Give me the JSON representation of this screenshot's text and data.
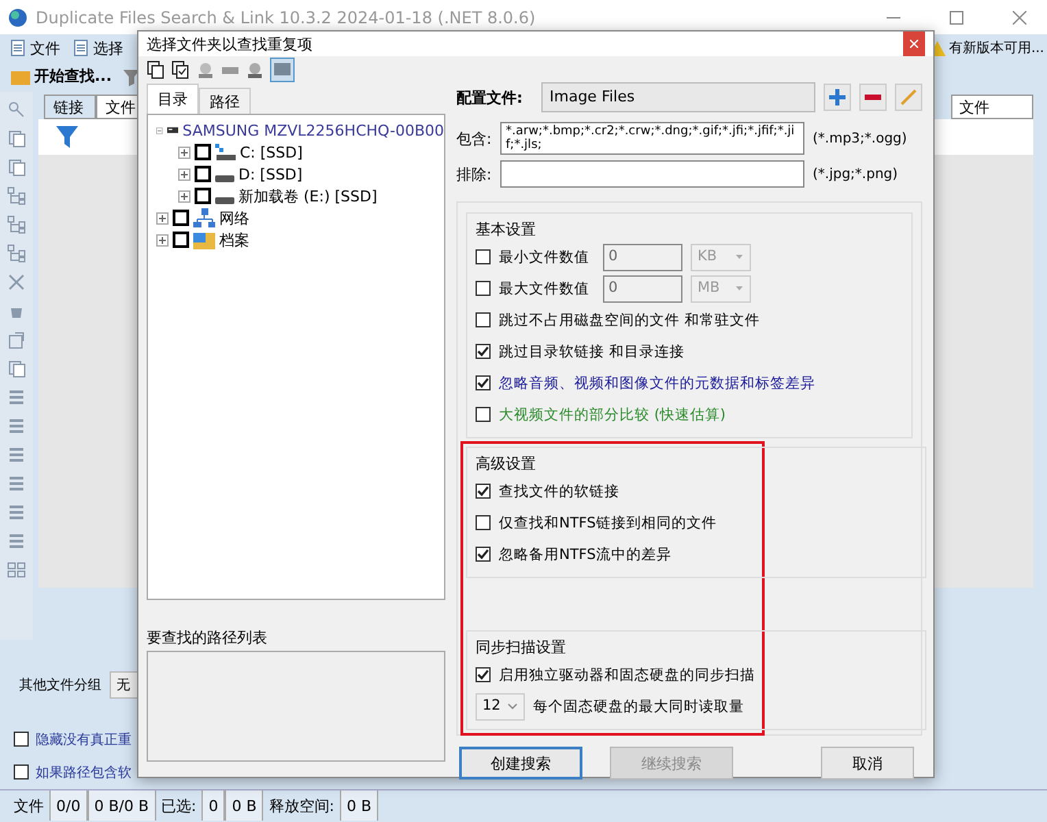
{
  "window": {
    "title": "Duplicate Files Search & Link 10.3.2 2024-01-18 (.NET 8.0.6)"
  },
  "menu": [
    {
      "label": "文件"
    },
    {
      "label": "选择"
    }
  ],
  "update_notice": "有新版本可用...",
  "start_button": "开始查找...",
  "tabs": [
    {
      "label": "链接",
      "selected": true
    },
    {
      "label": "文件",
      "selected": false
    }
  ],
  "right_column": "文件",
  "group_by": {
    "label": "其他文件分组",
    "value": "无"
  },
  "bottom_options": [
    {
      "label": "隐藏没有真正重",
      "checked": false
    },
    {
      "label": "如果路径包含软",
      "checked": false
    }
  ],
  "status_bar": [
    {
      "kind": "label",
      "text": "文件"
    },
    {
      "kind": "value",
      "text": "0/0"
    },
    {
      "kind": "value",
      "text": "0 B/0 B"
    },
    {
      "kind": "label",
      "text": "已选:"
    },
    {
      "kind": "value",
      "text": "0"
    },
    {
      "kind": "value",
      "text": "0 B"
    },
    {
      "kind": "label",
      "text": "释放空间:"
    },
    {
      "kind": "value",
      "text": "0 B"
    }
  ],
  "dialog": {
    "title": "选择文件夹以查找重复项",
    "tabs": [
      {
        "label": "目录",
        "selected": true
      },
      {
        "label": "路径",
        "selected": false
      }
    ],
    "tree": [
      {
        "kind": "device",
        "label": "SAMSUNG MZVL2256HCHQ-00B00",
        "expanded": true,
        "children": [
          {
            "kind": "system-drive",
            "label": "C: [SSD]",
            "checked": false,
            "expanded": false
          },
          {
            "kind": "drive",
            "label": "D: [SSD]",
            "checked": false,
            "expanded": false
          },
          {
            "kind": "drive",
            "label": "新加载卷 (E:) [SSD]",
            "checked": false,
            "expanded": false
          }
        ]
      },
      {
        "kind": "network",
        "label": "网络",
        "checked": false,
        "expanded": false
      },
      {
        "kind": "archive",
        "label": "档案",
        "checked": false,
        "expanded": false
      }
    ],
    "path_list_label": "要查找的路径列表",
    "profile": {
      "label": "配置文件:",
      "value": "Image Files"
    },
    "include": {
      "label": "包含:",
      "value": "*.arw;*.bmp;*.cr2;*.crw;*.dng;*.gif;*.jfi;*.jfif;*.jif;*.jls;",
      "hint": "(*.mp3;*.ogg)"
    },
    "exclude": {
      "label": "排除:",
      "hint": "(*.jpg;*.png)"
    },
    "basic": {
      "title": "基本设置",
      "options": [
        {
          "kind": "size",
          "label": "最小文件数值",
          "checked": false,
          "value": "0",
          "unit": "KB",
          "color": "#000000"
        },
        {
          "kind": "size",
          "label": "最大文件数值",
          "checked": false,
          "value": "0",
          "unit": "MB",
          "color": "#000000"
        },
        {
          "kind": "check",
          "label": "跳过不占用磁盘空间的文件 和常驻文件",
          "checked": false,
          "color": "#000000"
        },
        {
          "kind": "check",
          "label": "跳过目录软链接 和目录连接",
          "checked": true,
          "color": "#000000"
        },
        {
          "kind": "check",
          "label": "忽略音频、视频和图像文件的元数据和标签差异",
          "checked": true,
          "color": "#1a1a9a"
        },
        {
          "kind": "check",
          "label": "大视频文件的部分比较 (快速估算)",
          "checked": false,
          "color": "#2a8a2a"
        }
      ]
    },
    "highlighted": true,
    "advanced": {
      "title": "高级设置",
      "options": [
        {
          "kind": "check",
          "label": "查找文件的软链接",
          "checked": true
        },
        {
          "kind": "check",
          "label": "仅查找和NTFS链接到相同的文件",
          "checked": false
        },
        {
          "kind": "check",
          "label": "忽略备用NTFS流中的差异",
          "checked": true
        }
      ]
    },
    "sync": {
      "title": "同步扫描设置",
      "options": [
        {
          "kind": "check",
          "label": "启用独立驱动器和固态硬盘的同步扫描",
          "checked": true
        },
        {
          "kind": "select",
          "value": "12",
          "label": "每个固态硬盘的最大同时读取量"
        }
      ]
    },
    "buttons": [
      {
        "label": "创建搜索",
        "disabled": false,
        "default": true
      },
      {
        "label": "继续搜索",
        "disabled": true,
        "default": false
      },
      {
        "label": "取消",
        "disabled": false,
        "default": false
      }
    ]
  }
}
